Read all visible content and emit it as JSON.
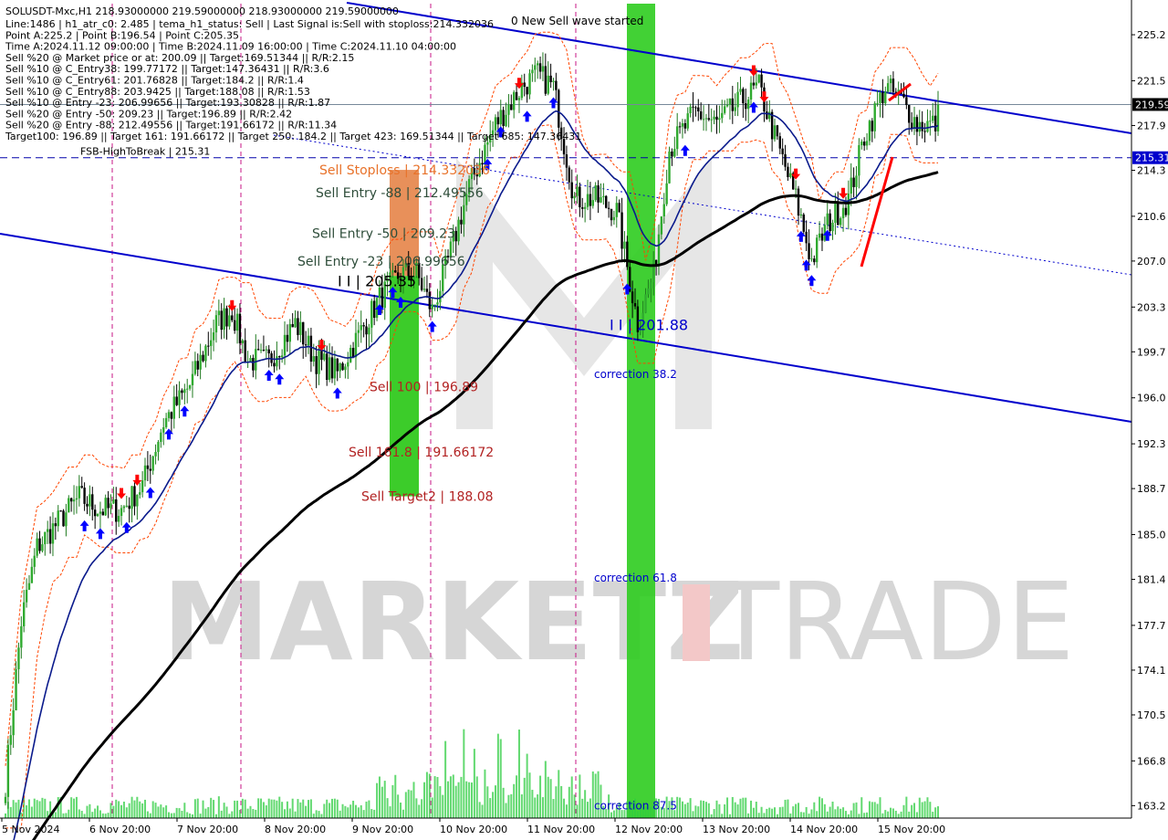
{
  "chart_data": {
    "type": "candlestick",
    "title": "SOLUSDT-Mxc,H1  218.93000000 219.59000000 218.93000000 219.59000000",
    "info_lines": [
      "Line:1486 | h1_atr_c0: 2.485 | tema_h1_status: Sell | Last Signal is:Sell with stoploss:214.332036",
      "Point A:225.2 | Point B:196.54 | Point C:205.35",
      "Time A:2024.11.12 09:00:00 | Time B:2024.11.09 16:00:00 | Time C:2024.11.10 04:00:00",
      "Sell %20 @ Market price or at: 200.09 || Target:169.51344 || R/R:2.15",
      "Sell %10 @ C_Entry38: 199.77172 || Target:147.36431 || R/R:3.6",
      "Sell %10 @ C_Entry61: 201.76828 || Target:184.2 || R/R:1.4",
      "Sell %10 @ C_Entry88: 203.9425 || Target:188.08 || R/R:1.53",
      "Sell %10 @ Entry -23: 206.99656 || Target:193.30828 || R/R:1.87",
      "Sell %20 @ Entry -50: 209.23 || Target:196.89 || R/R:2.42",
      "Sell %20 @ Entry -88: 212.49556 || Target:191.66172 || R/R:11.34",
      "Target100: 196.89 || Target 161: 191.66172 || Target 250: 184.2 || Target 423: 169.51344 || Target 685: 147.36431"
    ],
    "wave_label": "0 New Sell wave started",
    "y_ticks": [
      "225.2",
      "221.5",
      "217.9",
      "214.3",
      "210.6",
      "207.0",
      "203.3",
      "199.7",
      "196.0",
      "192.3",
      "188.7",
      "185.0",
      "181.4",
      "177.7",
      "174.1",
      "170.5",
      "166.8",
      "163.2"
    ],
    "ylim": [
      162.2,
      227.7
    ],
    "x_labels": [
      "5 Nov 2024",
      "6 Nov 20:00",
      "7 Nov 20:00",
      "8 Nov 20:00",
      "9 Nov 20:00",
      "10 Nov 20:00",
      "11 Nov 20:00",
      "12 Nov 20:00",
      "13 Nov 20:00",
      "14 Nov 20:00",
      "15 Nov 20:00"
    ],
    "current_price": {
      "value": 219.59,
      "label": "219.59"
    },
    "fsb_level": {
      "value": 215.31,
      "label": "215.31",
      "text": "FSB-HighToBreak | 215.31"
    },
    "levels": [
      {
        "name": "stoploss",
        "text": "Sell Stoploss | 214.332036",
        "value": 214.33,
        "color": "#e8722a"
      },
      {
        "name": "entry-88",
        "text": "Sell Entry -88 | 212.49556",
        "value": 212.5,
        "color": "#2e4d3a"
      },
      {
        "name": "entry-50",
        "text": "Sell Entry -50 | 209.23",
        "value": 209.23,
        "color": "#2e4d3a"
      },
      {
        "name": "entry-23",
        "text": "Sell Entry -23 | 206.99656",
        "value": 207.0,
        "color": "#2e4d3a"
      },
      {
        "name": "target100",
        "text": "Sell 100 | 196.89",
        "value": 196.89,
        "color": "#b22222"
      },
      {
        "name": "target161",
        "text": "Sell 161.8 | 191.66172",
        "value": 191.66,
        "color": "#b22222"
      },
      {
        "name": "target2",
        "text": "Sell Target2 | 188.08",
        "value": 188.08,
        "color": "#b22222"
      }
    ],
    "point_labels": [
      {
        "text": "I I | 205.35",
        "value": 205.35
      },
      {
        "text": "I I | 201.88",
        "value": 201.88
      }
    ],
    "corrections": [
      {
        "text": "correction 38.2",
        "value": 197.9
      },
      {
        "text": "correction 61.8",
        "value": 181.5
      },
      {
        "text": "correction 87.5",
        "value": 163.2
      }
    ],
    "watermark": {
      "left": "MARKETZ",
      "right": "TRADE"
    },
    "colors": {
      "ema_fast": "#0a1a8c",
      "ema_slow": "#000000",
      "channel": "#0000cc",
      "band": "#ff4500",
      "buy_arrow": "#0000ff",
      "sell_arrow": "#ff0000",
      "volume": "#2ecc40",
      "green_zone": "#2ecc1f",
      "orange_zone": "#e8905a",
      "vline": "#c71585"
    }
  }
}
